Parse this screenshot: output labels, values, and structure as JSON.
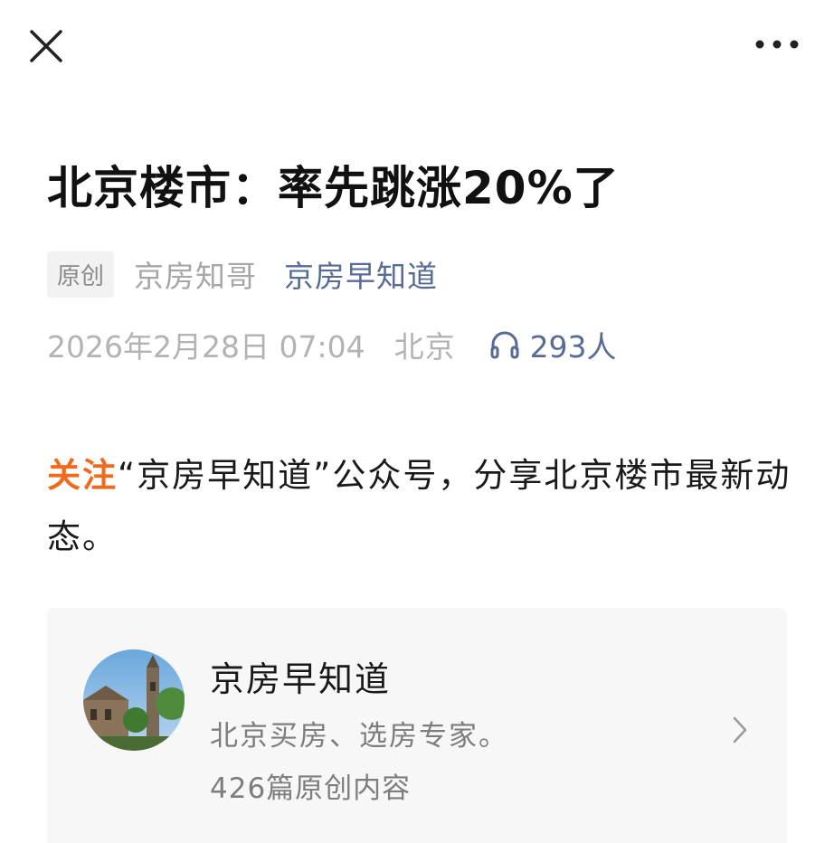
{
  "header": {
    "close_icon": "close-icon",
    "more_icon": "more-horizontal-icon"
  },
  "article": {
    "title": "北京楼市：率先跳涨20%了",
    "original_badge": "原创",
    "author": "京房知哥",
    "account_name": "京房早知道",
    "publish_time": "2026年2月28日 07:04",
    "location": "北京",
    "listen_icon": "headphones-icon",
    "listen_count": "293人",
    "intro_highlight": "关注",
    "intro_text": "“京房早知道”公众号，分享北京楼市最新动态。"
  },
  "profile_card": {
    "name": "京房早知道",
    "description": "北京买房、选房专家。",
    "article_count": "426篇原创内容",
    "chevron_icon": "chevron-right-icon"
  },
  "colors": {
    "link": "#576b95",
    "highlight": "#f06a1e",
    "card_bg": "#f7f7f7"
  }
}
